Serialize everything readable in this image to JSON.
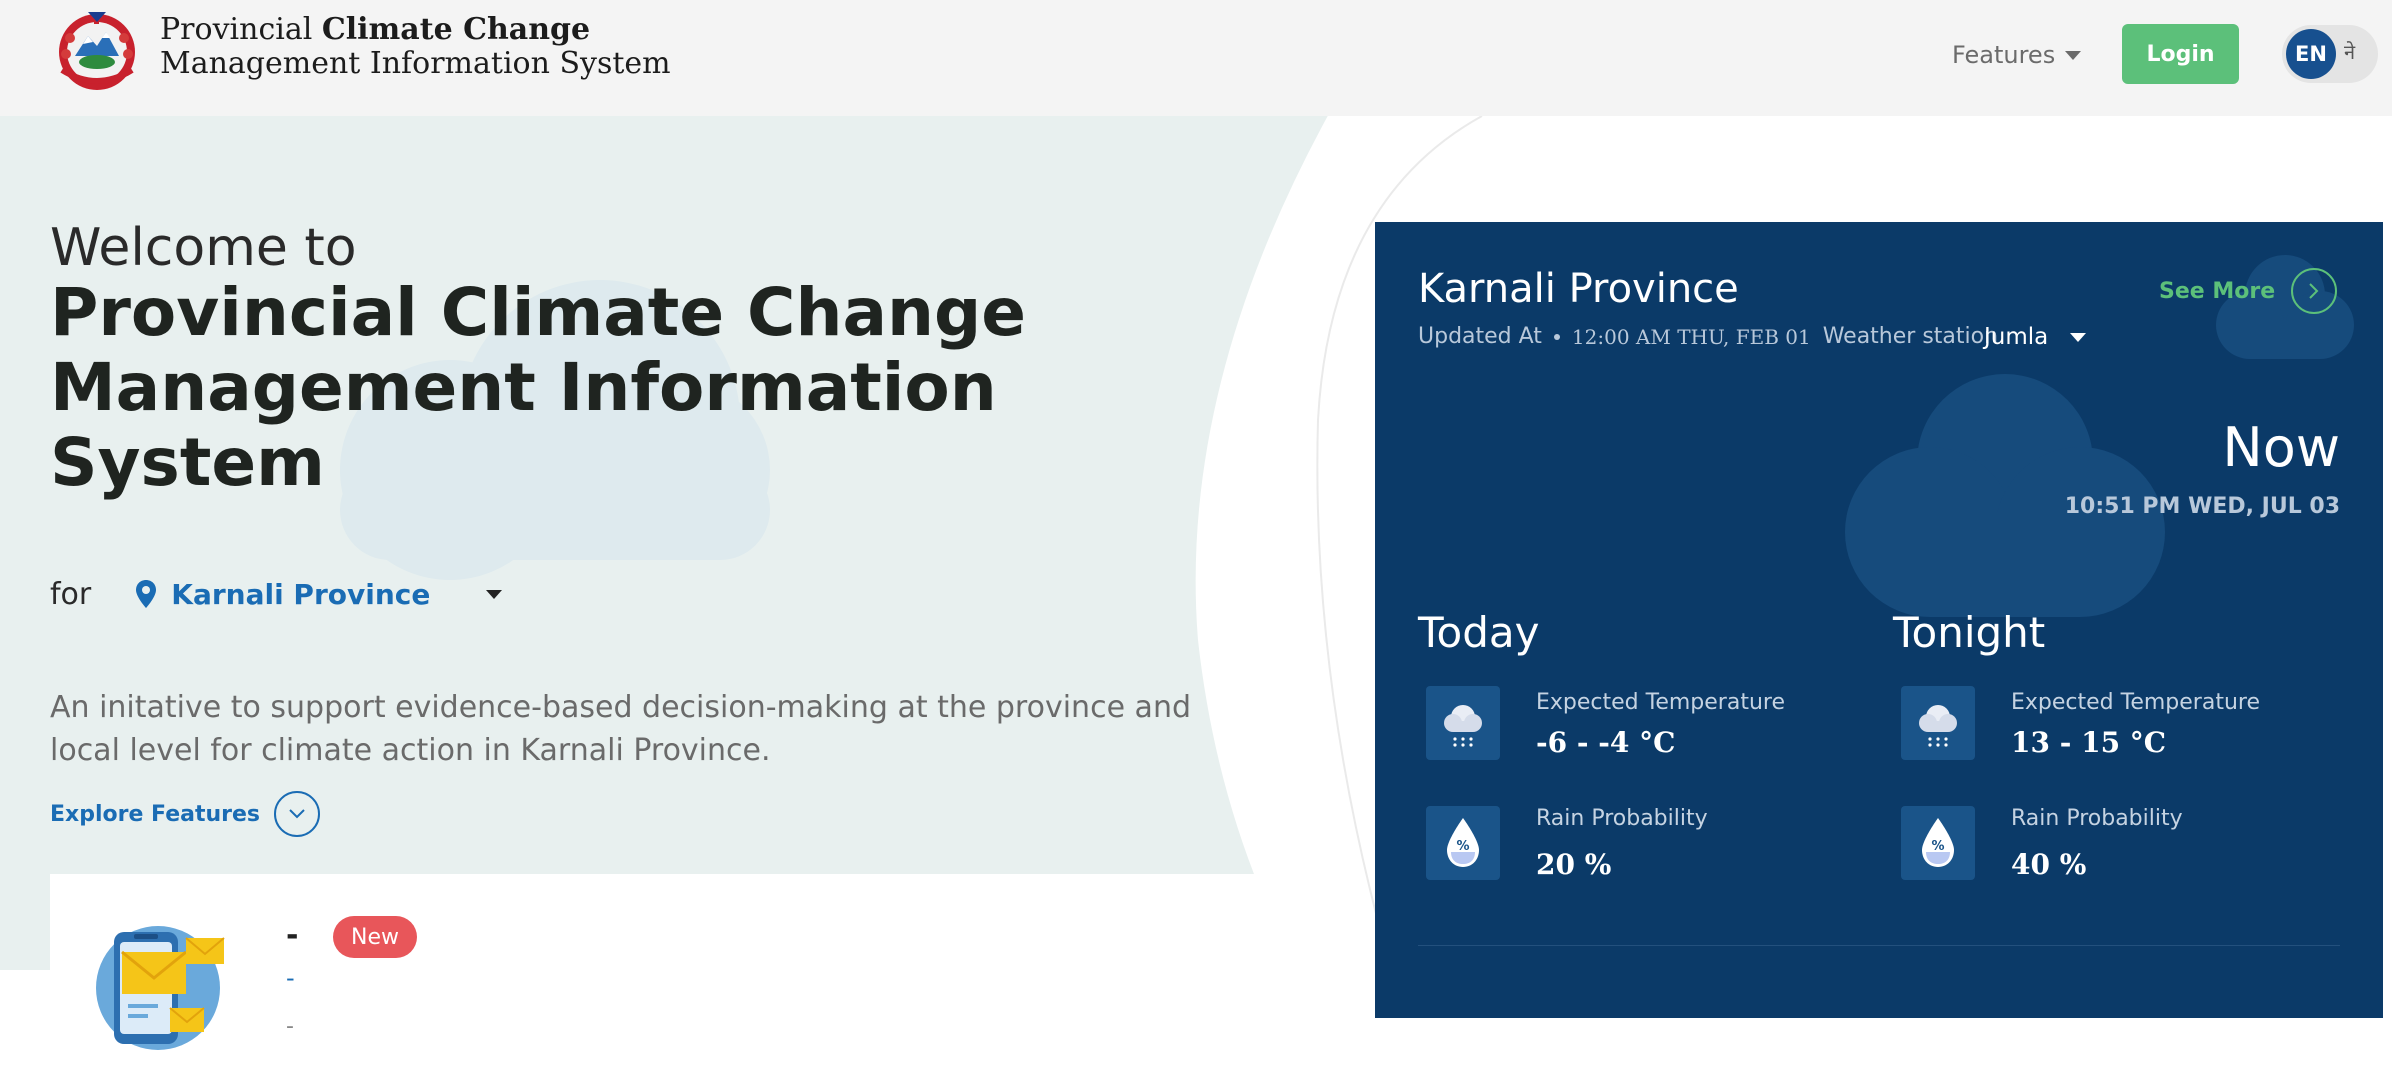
{
  "header": {
    "brand_line1_prefix": "Provincial ",
    "brand_line1_bold": "Climate Change",
    "brand_line2": "Management Information System",
    "features_label": "Features",
    "login_label": "Login",
    "lang_en": "EN",
    "lang_ne": "ने"
  },
  "hero": {
    "welcome": "Welcome to",
    "title_line1": "Provincial Climate Change",
    "title_line2": "Management Information",
    "title_line3": "System",
    "for_label": "for",
    "province": "Karnali Province",
    "description": "An initative to support evidence-based decision-making at the province and local level for climate action in Karnali Province.",
    "explore_label": "Explore Features"
  },
  "notice": {
    "title": "-",
    "badge": "New",
    "link": "-",
    "meta": "-"
  },
  "weather": {
    "province": "Karnali Province",
    "updated_label": "Updated At",
    "updated_time": "12:00 AM THU, FEB 01",
    "station_label": "Weather station",
    "station": "Jumla",
    "see_more": "See More",
    "now_label": "Now",
    "now_time": "10:51 PM WED, JUL 03",
    "today": {
      "title": "Today",
      "temp_label": "Expected Temperature",
      "temp_value": "-6 - -4 °C",
      "rain_label": "Rain Probability",
      "rain_value": "20 %"
    },
    "tonight": {
      "title": "Tonight",
      "temp_label": "Expected Temperature",
      "temp_value": "13 - 15 °C",
      "rain_label": "Rain Probability",
      "rain_value": "40 %"
    }
  },
  "colors": {
    "brand_green": "#5cc07a",
    "link_blue": "#1a6cb4",
    "panel_navy": "#0b3a68",
    "badge_red": "#e8565a"
  }
}
